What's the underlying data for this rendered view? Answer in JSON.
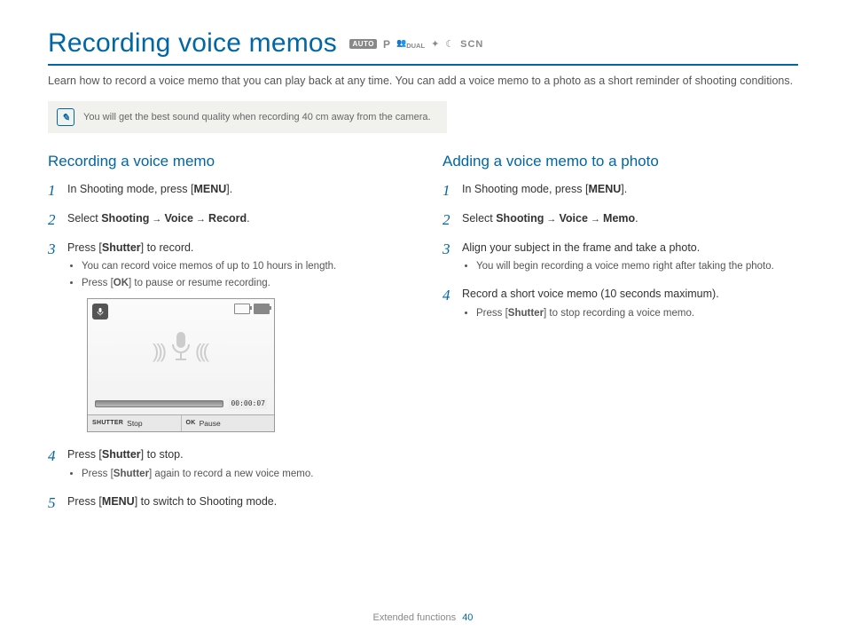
{
  "title": "Recording voice memos",
  "mode_icons": {
    "auto": "AUTO",
    "p": "P",
    "dual": "DUAL",
    "scn": "SCN"
  },
  "intro": "Learn how to record a voice memo that you can play back at any time. You can add a voice memo to a photo as a short reminder of shooting conditions.",
  "tip": "You will get the best sound quality when recording 40 cm away from the camera.",
  "left": {
    "heading": "Recording a voice memo",
    "s1_a": "In Shooting mode, press [",
    "s1_b": "MENU",
    "s1_c": "].",
    "s2_a": "Select ",
    "s2_b": "Shooting",
    "s2_c": " → ",
    "s2_d": "Voice",
    "s2_e": " → ",
    "s2_f": "Record",
    "s2_g": ".",
    "s3_a": "Press [",
    "s3_b": "Shutter",
    "s3_c": "] to record.",
    "s3_sub1": "You can record voice memos of up to 10 hours in length.",
    "s3_sub2_a": "Press [",
    "s3_sub2_b": "OK",
    "s3_sub2_c": "] to pause or resume recording.",
    "s4_a": "Press [",
    "s4_b": "Shutter",
    "s4_c": "] to stop.",
    "s4_sub_a": "Press [",
    "s4_sub_b": "Shutter",
    "s4_sub_c": "] again to record a new voice memo.",
    "s5_a": "Press [",
    "s5_b": "MENU",
    "s5_c": "] to switch to Shooting mode."
  },
  "right": {
    "heading": "Adding a voice memo to a photo",
    "s1_a": "In Shooting mode, press [",
    "s1_b": "MENU",
    "s1_c": "].",
    "s2_a": "Select ",
    "s2_b": "Shooting",
    "s2_c": " → ",
    "s2_d": "Voice",
    "s2_e": " → ",
    "s2_f": "Memo",
    "s2_g": ".",
    "s3": "Align your subject in the frame and take a photo.",
    "s3_sub": "You will begin recording a voice memo right after taking the photo.",
    "s4": "Record a short voice memo (10 seconds maximum).",
    "s4_sub_a": "Press [",
    "s4_sub_b": "Shutter",
    "s4_sub_c": "] to stop recording a voice memo."
  },
  "screenshot": {
    "time": "00:00:07",
    "shutter_label": "SHUTTER",
    "stop": "Stop",
    "ok_label": "OK",
    "pause": "Pause"
  },
  "footer": {
    "section": "Extended functions",
    "page": "40"
  }
}
